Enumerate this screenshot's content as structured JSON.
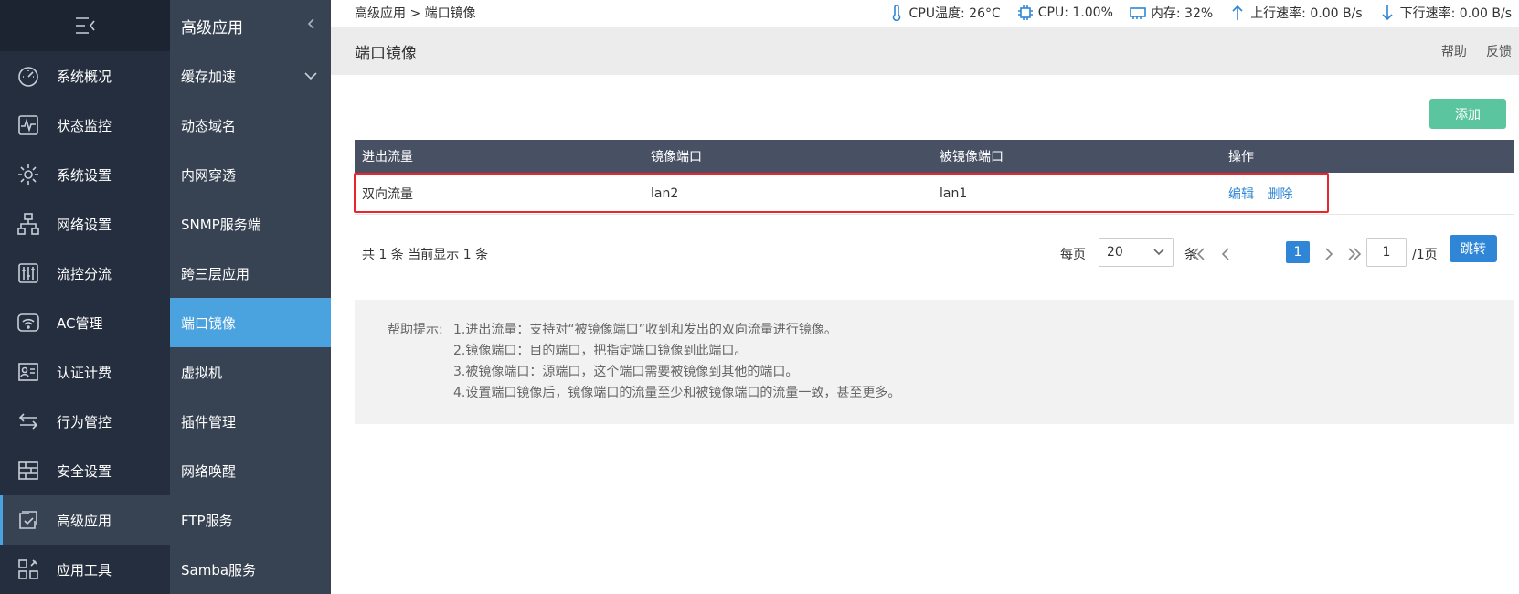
{
  "nav1": {
    "items": [
      {
        "label": "系统概况",
        "icon": "gauge-icon"
      },
      {
        "label": "状态监控",
        "icon": "pulse-icon"
      },
      {
        "label": "系统设置",
        "icon": "gear-icon"
      },
      {
        "label": "网络设置",
        "icon": "network-icon"
      },
      {
        "label": "流控分流",
        "icon": "sliders-icon"
      },
      {
        "label": "AC管理",
        "icon": "wifi-icon"
      },
      {
        "label": "认证计费",
        "icon": "id-card-icon"
      },
      {
        "label": "行为管控",
        "icon": "arrows-icon"
      },
      {
        "label": "安全设置",
        "icon": "firewall-icon"
      },
      {
        "label": "高级应用",
        "icon": "checklist-icon"
      },
      {
        "label": "应用工具",
        "icon": "tools-icon"
      }
    ],
    "active": "高级应用"
  },
  "nav2": {
    "title": "高级应用",
    "items": [
      "缓存加速",
      "动态域名",
      "内网穿透",
      "SNMP服务端",
      "跨三层应用",
      "端口镜像",
      "虚拟机",
      "插件管理",
      "网络唤醒",
      "FTP服务",
      "Samba服务"
    ],
    "active": "端口镜像"
  },
  "topbar": {
    "breadcrumb": "高级应用 > 端口镜像",
    "cpu_temp": "CPU温度: 26°C",
    "cpu": "CPU: 1.00%",
    "mem": "内存: 32%",
    "up": "上行速率: 0.00 B/s",
    "down": "下行速率: 0.00 B/s"
  },
  "page": {
    "title": "端口镜像",
    "help_link": "帮助",
    "feedback_link": "反馈",
    "add_button": "添加"
  },
  "table": {
    "headers": [
      "进出流量",
      "镜像端口",
      "被镜像端口",
      "操作"
    ],
    "rows": [
      {
        "flow": "双向流量",
        "mirror_port": "lan2",
        "mirrored_port": "lan1",
        "edit": "编辑",
        "delete": "删除"
      }
    ]
  },
  "pager": {
    "summary": "共 1 条 当前显示 1 条",
    "per_page_label": "每页",
    "per_page_value": "20",
    "unit": "条",
    "current_page": "1",
    "page_input": "1",
    "total_pages": "/1页",
    "jump": "跳转"
  },
  "help": {
    "label": "帮助提示:",
    "lines": [
      "1.进出流量：支持对“被镜像端口”收到和发出的双向流量进行镜像。",
      "2.镜像端口：目的端口，把指定端口镜像到此端口。",
      "3.被镜像端口：源端口，这个端口需要被镜像到其他的端口。",
      "4.设置端口镜像后，镜像端口的流量至少和被镜像端口的流量一致，甚至更多。"
    ]
  },
  "colors": {
    "sidebar": "#242e3e",
    "sidebar2": "#374253",
    "active": "#4aa3df",
    "add_button": "#5ac59f",
    "table_header": "#485164",
    "link": "#2f86d6",
    "highlight": "#e8262b"
  }
}
